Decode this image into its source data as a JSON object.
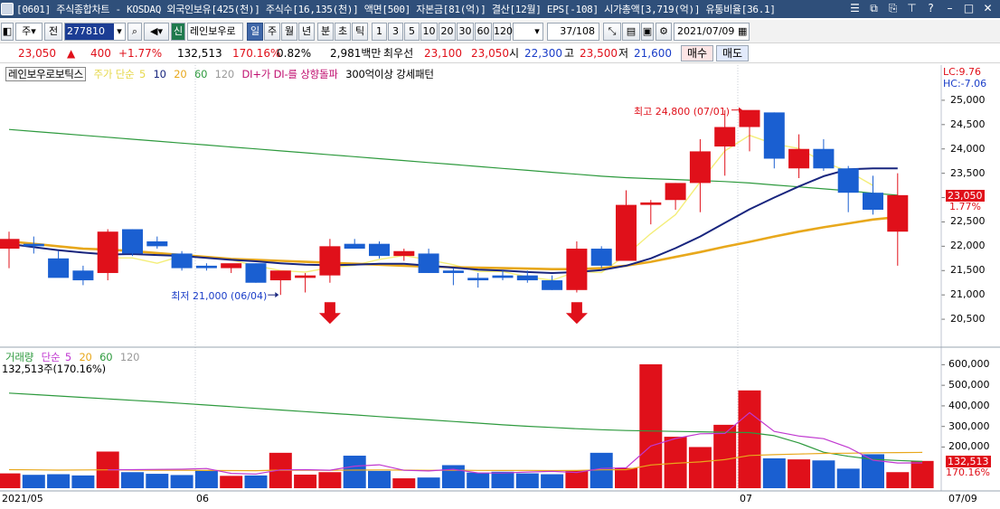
{
  "window": {
    "title": "[0601] 주식종합차트 - KOSDAQ 외국인보유[425(천)] 주식수[16,135(천)] 액면[500] 자본금[81(억)] 결산[12월] EPS[-108] 시가총액[3,719(억)] 유통비율[36.1]"
  },
  "toolbar": {
    "market_label": "주",
    "prev_label": "전",
    "code": "277810",
    "sin_label": "신",
    "name": "레인보우로",
    "periods": [
      "일",
      "주",
      "월",
      "년",
      "분",
      "초",
      "틱"
    ],
    "active_period": "일",
    "intervals": [
      "1",
      "3",
      "5",
      "10",
      "20",
      "30",
      "60",
      "120"
    ],
    "page_counter": "37/108",
    "date": "2021/07/09"
  },
  "quote": {
    "price": "23,050",
    "change": "400",
    "change_pct": "+1.77%",
    "volume": "132,513",
    "volume_pct": "170.16%",
    "turnover": "0.82%",
    "amount": "2,981백만",
    "best_ask_label": "최우선",
    "best_ask": "23,100",
    "best_bid": "23,050",
    "open_label": "시",
    "open": "22,300",
    "high_label": "고",
    "high": "23,500",
    "low_label": "저",
    "low": "21,600",
    "buy_label": "매수",
    "sell_label": "매도"
  },
  "price_legend": {
    "name": "레인보우로보틱스",
    "ma_prefix": "주가 단순",
    "ma_periods": [
      "5",
      "10",
      "20",
      "60",
      "120"
    ],
    "signal1": "DI+가 DI-를 상향돌파",
    "signal2": "300억이상 강세패턴"
  },
  "volume_legend": {
    "label": "거래량",
    "ma_prefix": "단순",
    "ma_periods": [
      "5",
      "20",
      "60",
      "120"
    ],
    "current": "132,513주(170.16%)"
  },
  "right_axis": {
    "lc": "LC:9.76",
    "hc": "HC:-7.06",
    "price_ticks": [
      "25,000",
      "24,500",
      "24,000",
      "23,500",
      "23,000",
      "22,500",
      "22,000",
      "21,500",
      "21,000",
      "20,500"
    ],
    "volume_ticks": [
      "600,000",
      "500,000",
      "400,000",
      "300,000",
      "200,000"
    ],
    "price_tag": "23,050",
    "price_tag_pct": "1.77%",
    "volume_tag": "132,513",
    "volume_tag_pct": "170.16%"
  },
  "x_axis": {
    "labels": [
      "2021/05",
      "06",
      "07"
    ],
    "end_label": "07/09"
  },
  "annotations": {
    "high_label": "최고 24,800 (07/01)",
    "low_label": "최저 21,000 (06/04)"
  },
  "colors": {
    "up": "#e0101a",
    "down": "#1a5fd1",
    "ma5": "#f4ee7a",
    "ma10": "#18257e",
    "ma20": "#e8a81c",
    "ma60": "#2e9a3e",
    "ma120": "#9a9a9a",
    "vol_ma5": "#c038d0",
    "vol_ma20": "#e8a81c",
    "vol_ma60": "#2e9a3e"
  },
  "chart_data": {
    "type": "candlestick",
    "candles": [
      {
        "o": 21950,
        "h": 22300,
        "l": 21550,
        "c": 22150
      },
      {
        "o": 22050,
        "h": 22200,
        "l": 21850,
        "c": 22000
      },
      {
        "o": 21750,
        "h": 21900,
        "l": 21400,
        "c": 21350
      },
      {
        "o": 21500,
        "h": 21600,
        "l": 21200,
        "c": 21300
      },
      {
        "o": 21450,
        "h": 22350,
        "l": 21300,
        "c": 22300
      },
      {
        "o": 22350,
        "h": 22350,
        "l": 21800,
        "c": 21850
      },
      {
        "o": 22100,
        "h": 22200,
        "l": 21950,
        "c": 22000
      },
      {
        "o": 21850,
        "h": 21900,
        "l": 21500,
        "c": 21550
      },
      {
        "o": 21600,
        "h": 21650,
        "l": 21500,
        "c": 21550
      },
      {
        "o": 21550,
        "h": 21600,
        "l": 21450,
        "c": 21650
      },
      {
        "o": 21650,
        "h": 21650,
        "l": 21250,
        "c": 21250
      },
      {
        "o": 21300,
        "h": 21450,
        "l": 21000,
        "c": 21500
      },
      {
        "o": 21350,
        "h": 21450,
        "l": 21050,
        "c": 21400
      },
      {
        "o": 21400,
        "h": 22150,
        "l": 21250,
        "c": 22000
      },
      {
        "o": 22050,
        "h": 22150,
        "l": 21950,
        "c": 21950
      },
      {
        "o": 22050,
        "h": 22100,
        "l": 21750,
        "c": 21800
      },
      {
        "o": 21800,
        "h": 21950,
        "l": 21700,
        "c": 21900
      },
      {
        "o": 21850,
        "h": 21950,
        "l": 21450,
        "c": 21450
      },
      {
        "o": 21500,
        "h": 21550,
        "l": 21200,
        "c": 21450
      },
      {
        "o": 21350,
        "h": 21450,
        "l": 21150,
        "c": 21300
      },
      {
        "o": 21400,
        "h": 21500,
        "l": 21300,
        "c": 21350
      },
      {
        "o": 21400,
        "h": 21500,
        "l": 21250,
        "c": 21300
      },
      {
        "o": 21300,
        "h": 21400,
        "l": 21100,
        "c": 21100
      },
      {
        "o": 21100,
        "h": 22100,
        "l": 21050,
        "c": 21950
      },
      {
        "o": 21950,
        "h": 22000,
        "l": 21550,
        "c": 21600
      },
      {
        "o": 21700,
        "h": 23150,
        "l": 21700,
        "c": 22850
      },
      {
        "o": 22850,
        "h": 22950,
        "l": 22450,
        "c": 22900
      },
      {
        "o": 22950,
        "h": 23300,
        "l": 22750,
        "c": 23300
      },
      {
        "o": 23300,
        "h": 24200,
        "l": 22700,
        "c": 23950
      },
      {
        "o": 24050,
        "h": 24800,
        "l": 23450,
        "c": 24450
      },
      {
        "o": 24450,
        "h": 24650,
        "l": 23950,
        "c": 24800
      },
      {
        "o": 24750,
        "h": 24750,
        "l": 23600,
        "c": 23800
      },
      {
        "o": 23600,
        "h": 24300,
        "l": 23400,
        "c": 24000
      },
      {
        "o": 24000,
        "h": 24200,
        "l": 23550,
        "c": 23600
      },
      {
        "o": 23600,
        "h": 23650,
        "l": 22700,
        "c": 23100
      },
      {
        "o": 23100,
        "h": 23450,
        "l": 22650,
        "c": 22750
      },
      {
        "o": 22300,
        "h": 23500,
        "l": 21600,
        "c": 23050
      }
    ],
    "volumes": [
      72000,
      65000,
      68000,
      62000,
      178000,
      78000,
      70000,
      64000,
      88000,
      60000,
      62000,
      172000,
      66000,
      78000,
      158000,
      84000,
      48000,
      52000,
      112000,
      76000,
      80000,
      72000,
      68000,
      86000,
      172000,
      98000,
      602000,
      250000,
      200000,
      308000,
      475000,
      145000,
      140000,
      135000,
      95000,
      165000,
      78000,
      132513
    ],
    "ma5": [
      null,
      null,
      null,
      null,
      21760,
      21760,
      21650,
      21800,
      21790,
      21720,
      21600,
      21500,
      21470,
      21560,
      21610,
      21730,
      21810,
      21720,
      21620,
      21480,
      21480,
      21370,
      21300,
      21480,
      21460,
      21820,
      22260,
      22650,
      23320,
      23960,
      24280,
      24100,
      24010,
      23730,
      23540,
      23250
    ],
    "ma10": [
      22050,
      21980,
      21920,
      21870,
      21830,
      21840,
      21820,
      21800,
      21760,
      21720,
      21690,
      21650,
      21620,
      21610,
      21620,
      21640,
      21640,
      21600,
      21560,
      21520,
      21500,
      21470,
      21450,
      21470,
      21510,
      21600,
      21750,
      21960,
      22200,
      22480,
      22760,
      23000,
      23230,
      23440,
      23580,
      23600,
      23600
    ],
    "ma20": [
      22100,
      22050,
      22000,
      21950,
      21930,
      21900,
      21860,
      21820,
      21780,
      21740,
      21720,
      21700,
      21680,
      21660,
      21640,
      21620,
      21600,
      21580,
      21570,
      21560,
      21550,
      21540,
      21530,
      21530,
      21550,
      21600,
      21680,
      21780,
      21880,
      21990,
      22090,
      22200,
      22300,
      22390,
      22470,
      22550,
      22600
    ],
    "ma60": [
      24400,
      24360,
      24320,
      24280,
      24240,
      24200,
      24160,
      24120,
      24080,
      24040,
      24000,
      23960,
      23920,
      23880,
      23840,
      23800,
      23760,
      23720,
      23680,
      23640,
      23600,
      23560,
      23520,
      23480,
      23440,
      23410,
      23390,
      23370,
      23350,
      23330,
      23300,
      23260,
      23220,
      23180,
      23140,
      23090,
      23050
    ],
    "vol_ma5": [
      null,
      null,
      null,
      null,
      89000,
      90200,
      91200,
      92400,
      95600,
      72000,
      68800,
      89200,
      90000,
      87600,
      107200,
      113600,
      86800,
      84000,
      92000,
      74400,
      73600,
      78800,
      81600,
      76400,
      95600,
      99200,
      205200,
      241600,
      264400,
      266000,
      367000,
      275600,
      253600,
      240600,
      198000,
      136000,
      122600,
      123000
    ],
    "vol_ma20": [
      90000,
      89000,
      88000,
      88500,
      89000,
      88000,
      87500,
      87000,
      86000,
      85500,
      85000,
      88000,
      87500,
      87000,
      88000,
      88500,
      88000,
      87000,
      87500,
      86500,
      86000,
      86500,
      85500,
      86000,
      89000,
      90000,
      113000,
      121000,
      128000,
      139000,
      159000,
      163000,
      166000,
      169000,
      170000,
      172000,
      173000,
      174000
    ],
    "vol_ma60": [
      462000,
      455000,
      448000,
      441000,
      434000,
      427000,
      420000,
      412000,
      404000,
      396000,
      388000,
      380000,
      372000,
      364000,
      356000,
      348000,
      340000,
      332000,
      324000,
      316000,
      308000,
      301000,
      295000,
      289000,
      284000,
      280000,
      278000,
      276000,
      274000,
      272000,
      270000,
      255000,
      220000,
      175000,
      155000,
      140000,
      135000,
      130000
    ],
    "price_range": [
      20000,
      25500
    ],
    "volume_range": [
      0,
      650000
    ]
  }
}
